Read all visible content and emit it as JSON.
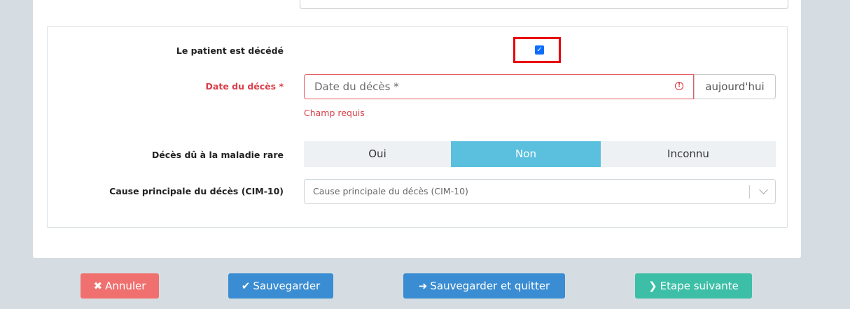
{
  "form": {
    "deceased_label": "Le patient est décédé",
    "deceased_checked": true,
    "date_label": "Date du décès *",
    "date_value": "",
    "date_placeholder": "Date du décès *",
    "today_label": "aujourd'hui",
    "date_error": "Champ requis",
    "rare_label": "Décès dû à la maladie rare",
    "rare_options": [
      "Oui",
      "Non",
      "Inconnu"
    ],
    "rare_selected": "Non",
    "cause_label": "Cause principale du décès (CIM-10)",
    "cause_placeholder": "Cause principale du décès (CIM-10)"
  },
  "actions": {
    "cancel": "Annuler",
    "save": "Sauvegarder",
    "save_quit": "Sauvegarder et quitter",
    "next": "Etape suivante"
  },
  "colors": {
    "cancel": "#f0706f",
    "save": "#3a8dd2",
    "next": "#3dbfa7",
    "error": "#d93f4a",
    "segment_active": "#5bc0de"
  }
}
